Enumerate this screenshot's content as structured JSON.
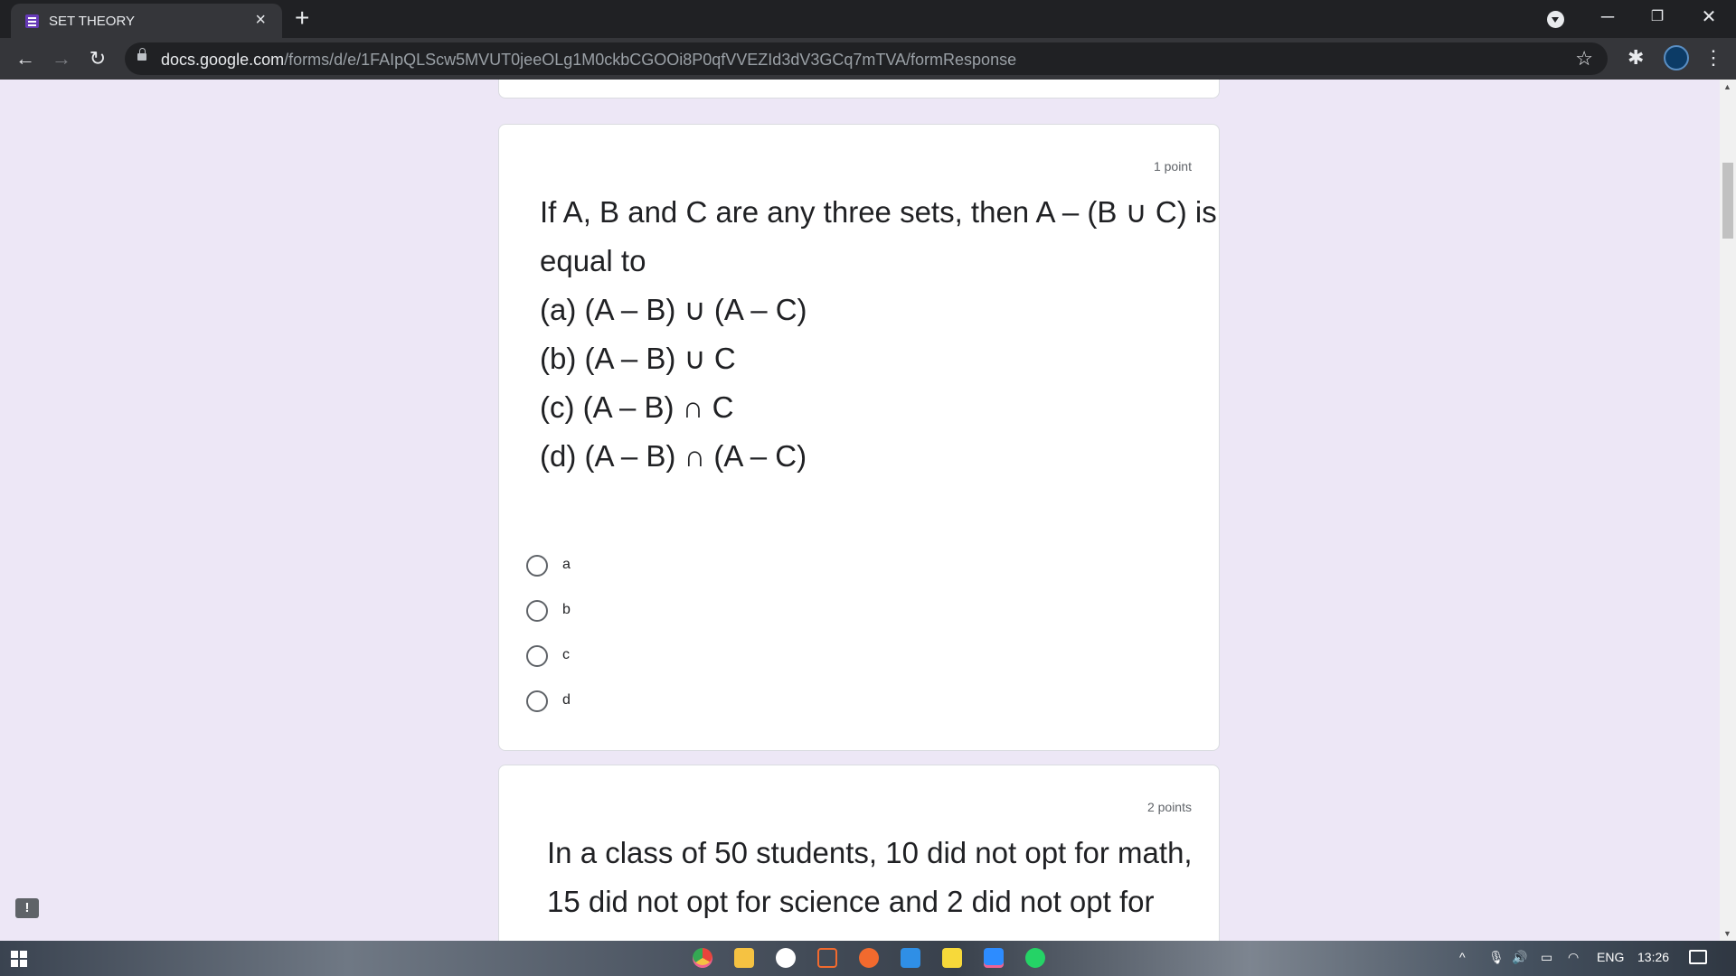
{
  "browser": {
    "tab_title": "SET THEORY",
    "tab_close": "×",
    "new_tab": "+",
    "url_host": "docs.google.com",
    "url_path": "/forms/d/e/1FAIpQLScw5MVUT0jeeOLg1M0ckbCGOOi8P0qfVVEZId3dV3GCq7mTVA/formResponse",
    "minimize": "─",
    "restore": "❐",
    "close": "✕",
    "back_icon": "←",
    "forward_icon": "→",
    "reload_icon": "↻",
    "star_icon": "☆",
    "extensions_icon": "✱",
    "menu_icon": "⋮"
  },
  "form": {
    "question1": {
      "points": "1 point",
      "text_lines": [
        "If A, B and C are any three sets, then A – (B ∪ C) is",
        "equal to",
        "(a) (A – B) ∪ (A – C)",
        "(b) (A – B) ∪ C",
        "(c) (A – B) ∩ C",
        "(d) (A – B) ∩ (A – C)"
      ],
      "options": [
        "a",
        "b",
        "c",
        "d"
      ]
    },
    "question2": {
      "points": "2 points",
      "text_lines": [
        "In a class of 50 students, 10 did not opt for math,",
        "15 did not opt for science and 2 did not opt for"
      ]
    },
    "feedback_icon": "!"
  },
  "taskbar": {
    "tray_caret": "^",
    "language": "ENG",
    "time": "13:26",
    "apps": [
      "chrome-icon",
      "file-explorer-icon",
      "app-icon",
      "terminal-icon",
      "pen-app-icon",
      "vscode-icon",
      "sticky-notes-icon",
      "zoom-icon",
      "whatsapp-icon"
    ],
    "colors": {
      "chrome": "#e8453c",
      "explorer": "#f5c242",
      "vscode": "#2f8fe6",
      "sticky": "#f7d93a",
      "zoom": "#2d8cff",
      "whatsapp": "#25d366",
      "pen": "#f26a2e"
    }
  }
}
